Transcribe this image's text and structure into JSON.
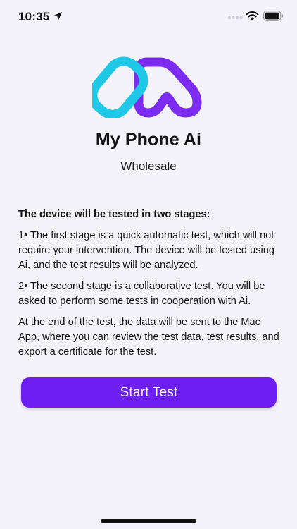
{
  "status_bar": {
    "time": "10:35",
    "icons": [
      "location-arrow-icon",
      "signal-dots-icon",
      "wifi-icon",
      "battery-icon"
    ]
  },
  "app": {
    "title": "My Phone Ai",
    "subtitle": "Wholesale",
    "logo_colors": [
      "#1ec8e6",
      "#7b2cf0"
    ]
  },
  "content": {
    "intro": "The device will be tested in two stages:",
    "stage1": "1• The first stage is a quick automatic test, which will not require your intervention. The device will be tested using Ai, and the test results will be analyzed.",
    "stage2": "2• The second stage is a collaborative test. You will be asked to perform some tests in cooperation with Ai.",
    "outro": "At the end of the test, the data will be sent to the Mac App, where you can review the test data, test results, and export a certificate for the test."
  },
  "actions": {
    "start_label": "Start Test",
    "accent": "#6d1ef0"
  }
}
